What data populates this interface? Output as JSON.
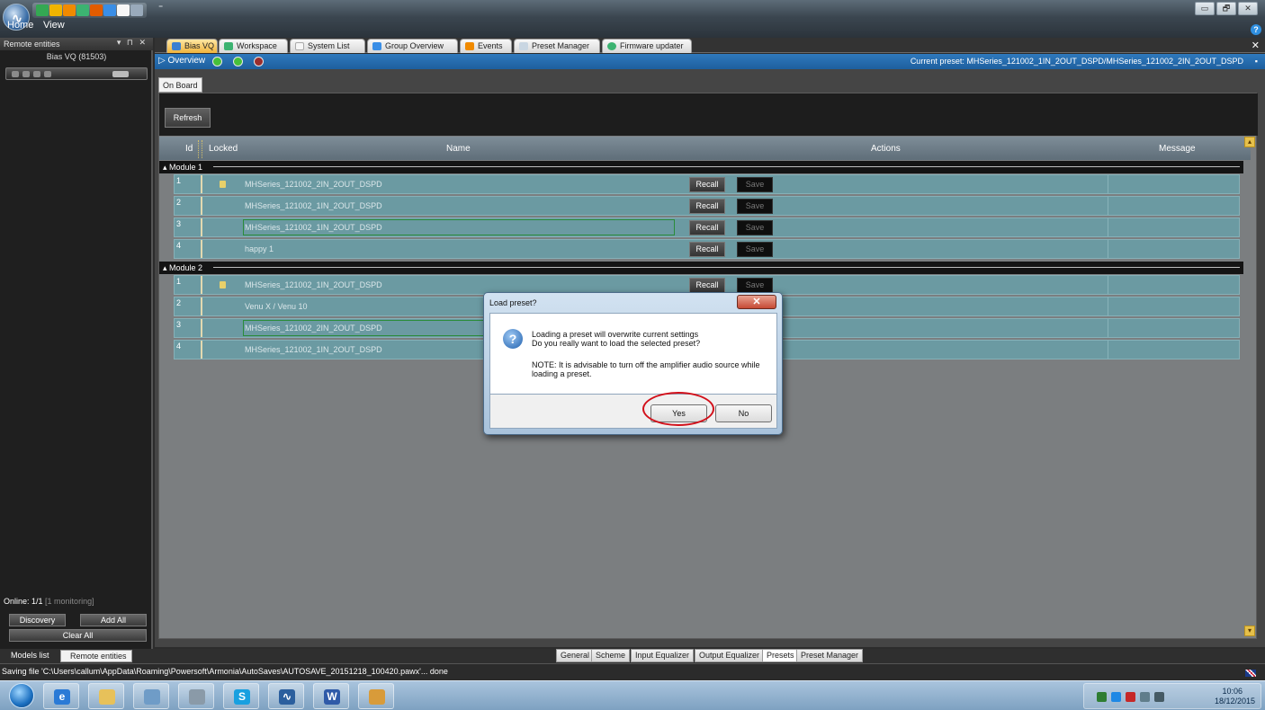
{
  "ribbon": {
    "menu": [
      "Home",
      "View"
    ],
    "qat_more": "⁼"
  },
  "window_controls": {
    "minimize": "▭",
    "maximize": "🗗",
    "close": "✕"
  },
  "help_icon": "?",
  "left_panel": {
    "title": "Remote entities",
    "header_controls": "▾ ⊓ ✕",
    "device_name": "Bias VQ (81503)",
    "online": "Online: 1/1",
    "monitoring": "[1 monitoring]",
    "discovery_label": "Discovery",
    "add_all_label": "Add All",
    "clear_all_label": "Clear All",
    "tabs": [
      "Models list",
      "Remote entities"
    ]
  },
  "main_tabs": [
    "Bias VQ",
    "Workspace",
    "System List",
    "Group Overview",
    "Events",
    "Preset Manager",
    "Firmware updater"
  ],
  "overview": {
    "label": "Overview",
    "current_preset": "Current preset: MHSeries_121002_1IN_2OUT_DSPD/MHSeries_121002_2IN_2OUT_DSPD"
  },
  "subtab": "On Board",
  "refresh_label": "Refresh",
  "grid": {
    "columns": [
      "Id",
      "Locked",
      "Name",
      "Actions",
      "Message"
    ],
    "recall_label": "Recall",
    "save_label": "Save",
    "modules": [
      {
        "title": "Module 1",
        "rows": [
          {
            "id": "1",
            "locked": true,
            "name": "MHSeries_121002_2IN_2OUT_DSPD",
            "selected": false
          },
          {
            "id": "2",
            "locked": false,
            "name": "MHSeries_121002_1IN_2OUT_DSPD",
            "selected": false
          },
          {
            "id": "3",
            "locked": false,
            "name": "MHSeries_121002_1IN_2OUT_DSPD",
            "selected": true
          },
          {
            "id": "4",
            "locked": false,
            "name": "happy 1",
            "selected": false
          }
        ]
      },
      {
        "title": "Module 2",
        "rows": [
          {
            "id": "1",
            "locked": true,
            "name": "MHSeries_121002_1IN_2OUT_DSPD",
            "selected": false
          },
          {
            "id": "2",
            "locked": false,
            "name": "Venu X / Venu 10",
            "selected": false
          },
          {
            "id": "3",
            "locked": false,
            "name": "MHSeries_121002_2IN_2OUT_DSPD",
            "selected": true
          },
          {
            "id": "4",
            "locked": false,
            "name": "MHSeries_121002_1IN_2OUT_DSPD",
            "selected": false
          }
        ]
      }
    ]
  },
  "bottom_tabs": [
    "General",
    "Scheme",
    "Input Equalizer",
    "Output Equalizer",
    "Presets",
    "Preset Manager"
  ],
  "status_text": "Saving file 'C:\\Users\\callum\\AppData\\Roaming\\Powersoft\\Armonia\\AutoSaves\\AUTOSAVE_20151218_100420.pawx'... done",
  "dialog": {
    "title": "Load preset?",
    "close": "✕",
    "line1": "Loading a preset will overwrite current settings",
    "line2": "Do you really want to load the selected preset?",
    "note1": "NOTE: It is advisable to turn off the amplifier audio source while",
    "note2": "loading a preset.",
    "yes_label": "Yes",
    "no_label": "No"
  },
  "taskbar": {
    "time": "10:06",
    "date": "18/12/2015"
  },
  "colors": {
    "accent_blue": "#1e5f9e",
    "row_teal": "#6b9aa2",
    "highlight_red": "#d2101a"
  }
}
